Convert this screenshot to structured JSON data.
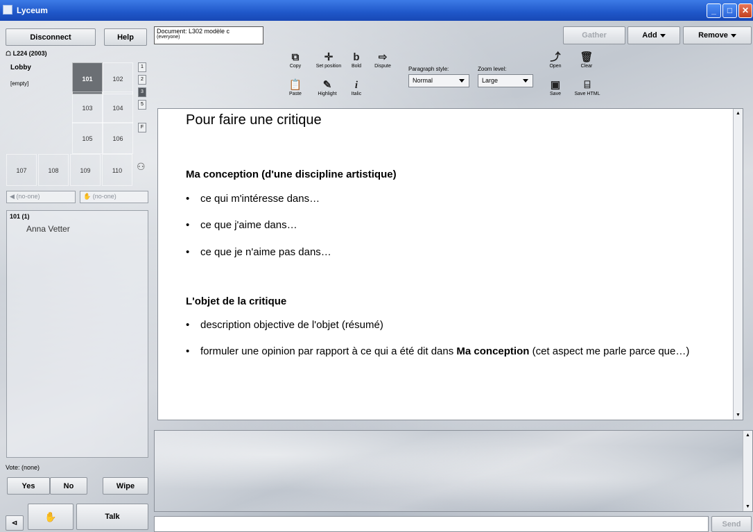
{
  "window": {
    "title": "Lyceum",
    "min_icon": "minimize-icon",
    "max_icon": "maximize-icon",
    "close_icon": "close-icon"
  },
  "left": {
    "disconnect_label": "Disconnect",
    "help_label": "Help",
    "building_label": "L224 (2003)",
    "lobby_label": "Lobby",
    "lobby_status": "[empty]",
    "rooms": [
      "101",
      "102",
      "103",
      "104",
      "105",
      "106",
      "107",
      "108",
      "109",
      "110"
    ],
    "active_room": "101",
    "side_buttons": [
      "1",
      "2",
      "3",
      "5",
      "F"
    ],
    "speaker_field": "(no-one)",
    "hand_field": "(no-one)",
    "room_header": "101 (1)",
    "users": [
      "Anna Vetter"
    ],
    "vote_label": "Vote: (none)",
    "yes_label": "Yes",
    "no_label": "No",
    "wipe_label": "Wipe",
    "talk_label": "Talk"
  },
  "document": {
    "name": "Document: L302 modèle c",
    "audience": "(everyone)",
    "gather_label": "Gather",
    "add_label": "Add",
    "remove_label": "Remove",
    "toolbar": {
      "copy": "Copy",
      "set_position": "Set position",
      "bold": "Bold",
      "dispute": "Dispute",
      "paste": "Paste",
      "highlight": "Highlight",
      "italic": "Italic",
      "paragraph_style_label": "Paragraph style:",
      "paragraph_style_value": "Normal",
      "zoom_level_label": "Zoom level:",
      "zoom_level_value": "Large",
      "open": "Open",
      "clear": "Clear",
      "save": "Save",
      "save_html": "Save HTML"
    },
    "content": {
      "title": "Pour faire une critique",
      "section1_heading": "Ma conception (d'une discipline artistique)",
      "section1_items": [
        "ce qui m'intéresse dans…",
        "ce que j'aime dans…",
        "ce que je n'aime pas dans…"
      ],
      "section2_heading": "L'objet de la critique",
      "section2_item1": "description objective de l'objet (résumé)",
      "section2_item2_pre": "formuler une opinion par rapport à ce qui a été dit dans ",
      "section2_item2_bold": "Ma conception",
      "section2_item2_post": " (cet aspect me parle parce que…)"
    }
  },
  "chat": {
    "send_label": "Send"
  },
  "colors": {
    "titlebar": "#1f57c9",
    "active_room": "#6b6f74"
  }
}
